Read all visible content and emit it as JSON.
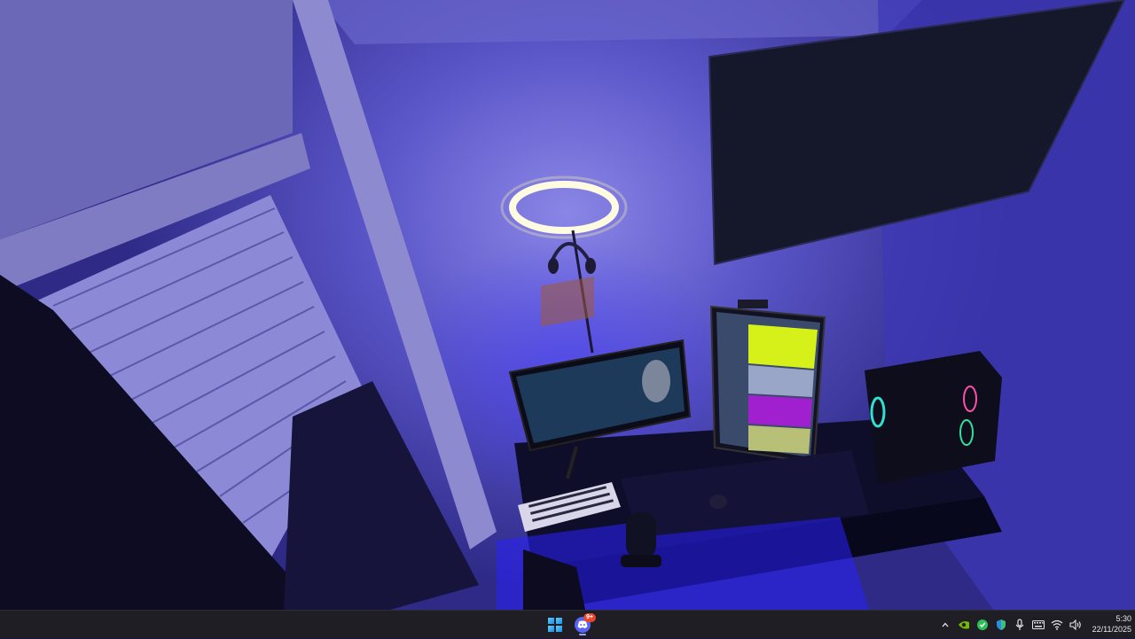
{
  "desktop": {
    "wallpaper": "photo-gaming-desk-blue-lighting",
    "accent_colors": {
      "room_glow": "#4a3cff",
      "ring_light": "#fffbe0",
      "monitor_yellow": "#d6f01a",
      "monitor_purple": "#a020d0"
    }
  },
  "taskbar": {
    "start_icon": "windows-logo-icon",
    "pinned_apps": [
      {
        "name": "Discord",
        "icon": "discord-icon",
        "badge": "9+"
      }
    ],
    "tray": {
      "icons": [
        "chevron-up-icon",
        "nvidia-icon",
        "green-app-icon",
        "shield-icon",
        "microphone-icon",
        "keyboard-icon",
        "wifi-icon",
        "speaker-icon"
      ]
    },
    "clock": {
      "time": "5:30",
      "date": "22/11/2025"
    }
  }
}
